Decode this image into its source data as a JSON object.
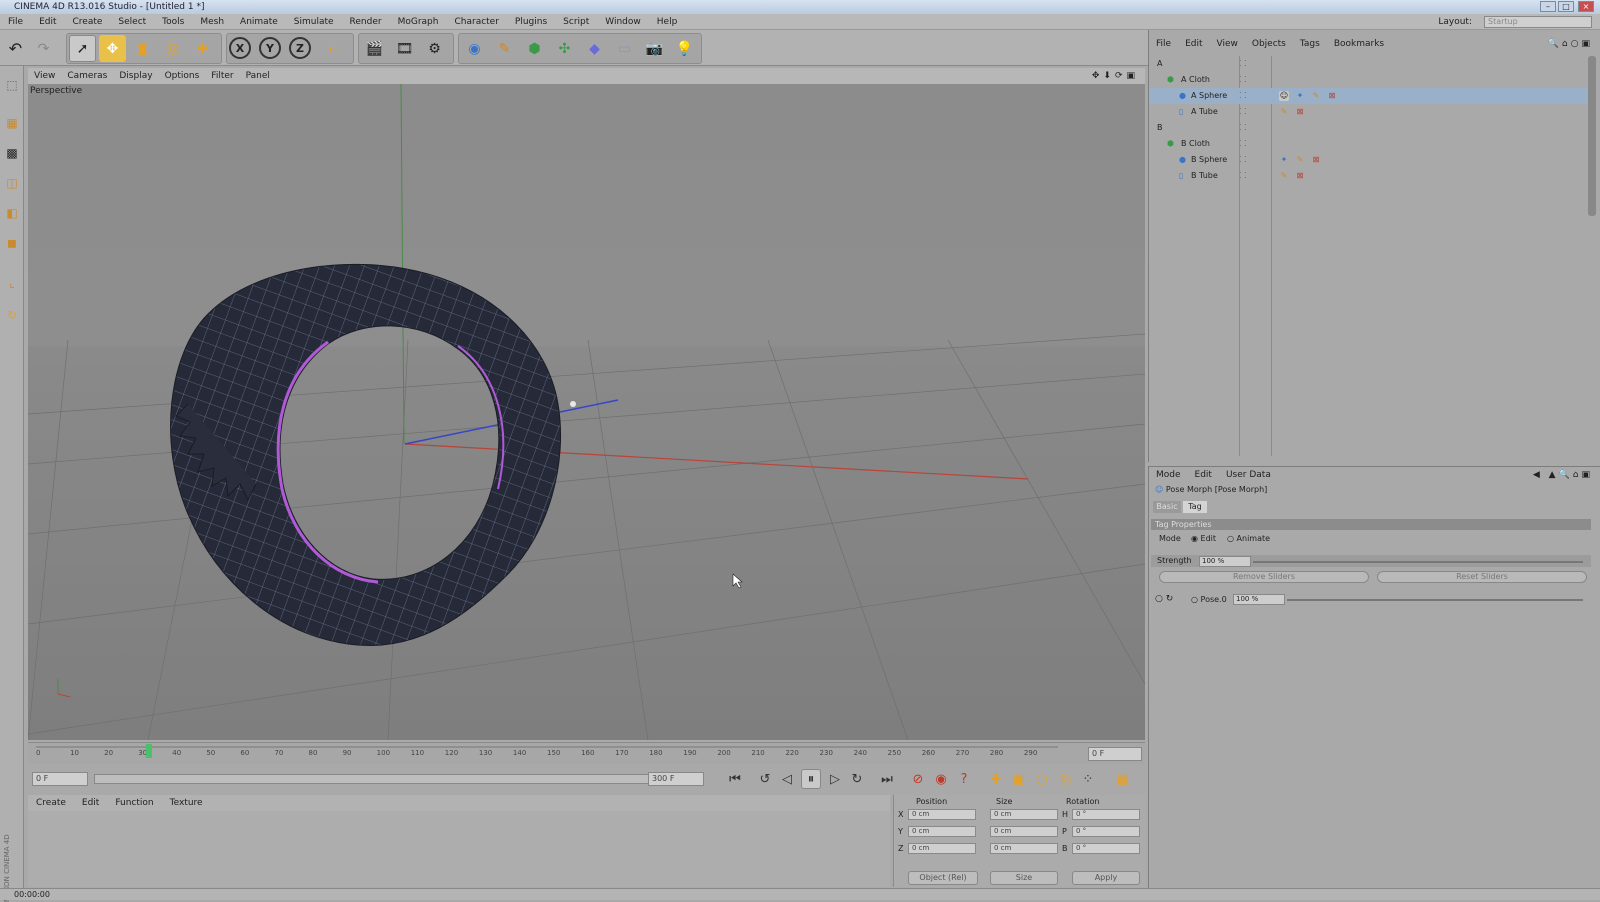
{
  "window": {
    "title": "CINEMA 4D R13.016 Studio - [Untitled 1 *]"
  },
  "menubar": {
    "items": [
      "File",
      "Edit",
      "Create",
      "Select",
      "Tools",
      "Mesh",
      "Animate",
      "Simulate",
      "Render",
      "MoGraph",
      "Character",
      "Plugins",
      "Script",
      "Window",
      "Help"
    ],
    "layout_label": "Layout:",
    "layout_value": "Startup"
  },
  "toolbar": {
    "axis_x": "X",
    "axis_y": "Y",
    "axis_z": "Z"
  },
  "viewport": {
    "menu": [
      "View",
      "Cameras",
      "Display",
      "Options",
      "Filter",
      "Panel"
    ],
    "label": "Perspective"
  },
  "timeline": {
    "ticks": [
      "0",
      "10",
      "20",
      "30",
      "40",
      "50",
      "60",
      "70",
      "80",
      "90",
      "100",
      "110",
      "120",
      "130",
      "140",
      "150",
      "160",
      "170",
      "180",
      "190",
      "200",
      "210",
      "220",
      "230",
      "240",
      "250",
      "260",
      "270",
      "280",
      "290"
    ],
    "current_frame": "30",
    "end_field": "0 F"
  },
  "transport": {
    "start": "0 F",
    "end": "300 F"
  },
  "material": {
    "menu": [
      "Create",
      "Edit",
      "Function",
      "Texture"
    ]
  },
  "coords": {
    "headers": [
      "Position",
      "Size",
      "Rotation"
    ],
    "rows": [
      {
        "axis": "X",
        "pos": "0 cm",
        "size": "0 cm",
        "rot_axis": "H",
        "rot": "0 °"
      },
      {
        "axis": "Y",
        "pos": "0 cm",
        "size": "0 cm",
        "rot_axis": "P",
        "rot": "0 °"
      },
      {
        "axis": "Z",
        "pos": "0 cm",
        "size": "0 cm",
        "rot_axis": "B",
        "rot": "0 °"
      }
    ],
    "mode": "Object (Rel)",
    "size_mode": "Size",
    "apply": "Apply"
  },
  "objects": {
    "menu": [
      "File",
      "Edit",
      "View",
      "Objects",
      "Tags",
      "Bookmarks"
    ],
    "items": [
      {
        "name": "A",
        "indent": 0
      },
      {
        "name": "A Cloth",
        "indent": 1
      },
      {
        "name": "A Sphere",
        "indent": 2
      },
      {
        "name": "A Tube",
        "indent": 2
      },
      {
        "name": "B",
        "indent": 0
      },
      {
        "name": "B Cloth",
        "indent": 1
      },
      {
        "name": "B Sphere",
        "indent": 2
      },
      {
        "name": "B Tube",
        "indent": 2
      }
    ]
  },
  "attributes": {
    "menu": [
      "Mode",
      "Edit",
      "User Data"
    ],
    "object": "Pose Morph [Pose Morph]",
    "tabs": [
      "Basic",
      "Tag"
    ],
    "section": "Tag Properties",
    "mode_label": "Mode",
    "mode_edit": "Edit",
    "mode_animate": "Animate",
    "strength_label": "Strength",
    "strength_value": "100 %",
    "remove_sliders": "Remove Sliders",
    "reset_sliders": "Reset Sliders",
    "pose_label": "Pose.0",
    "pose_value": "100 %"
  },
  "status": {
    "text": "00:00:00"
  },
  "side_logo": "MAXON CINEMA 4D",
  "colors": {
    "accent_orange": "#e8a020",
    "panel": "#a9a9a9",
    "x_axis": "#c0392b",
    "z_axis": "#3646c8"
  }
}
